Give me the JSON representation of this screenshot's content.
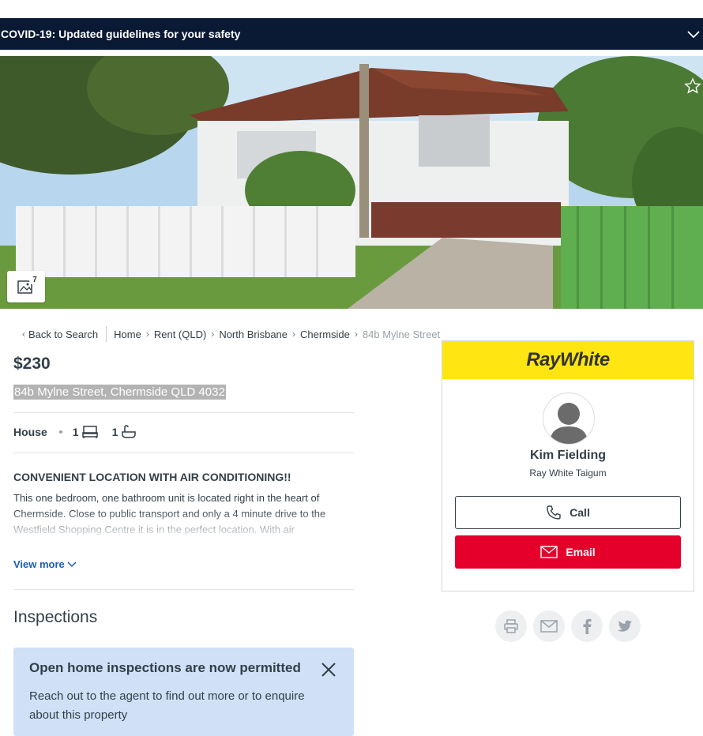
{
  "covid_banner": {
    "text": "COVID-19: Updated guidelines for your safety",
    "icon": "chevron-down-icon"
  },
  "hero": {
    "photo_count": "7",
    "favourite_icon": "star-icon",
    "gallery_icon": "gallery-icon"
  },
  "breadcrumb": {
    "back_label": "Back to Search",
    "items": [
      "Home",
      "Rent (QLD)",
      "North Brisbane",
      "Chermside"
    ],
    "current": "84b Mylne Street"
  },
  "listing": {
    "price": "$230",
    "address": "84b Mylne Street, Chermside QLD 4032",
    "property_type": "House",
    "bedrooms": "1",
    "bathrooms": "1",
    "headline": "CONVENIENT LOCATION WITH AIR CONDITIONING!!",
    "description": "This one bedroom, one bathroom unit is located right in the heart of Chermside. Close to public transport and only a 4 minute drive to the Westfield Shopping Centre it is in the perfect location. With air",
    "view_more_label": "View more"
  },
  "inspections": {
    "title": "Inspections",
    "notice_heading": "Open home inspections are now permitted",
    "notice_body": "Reach out to the agent to find out more or to enquire about this property"
  },
  "agent": {
    "agency_logo_text": "RayWhite",
    "name": "Kim Fielding",
    "agency": "Ray White Taigum",
    "call_label": "Call",
    "email_label": "Email",
    "brand_color": "#ffe512",
    "email_color": "#e4002b"
  },
  "share": {
    "icons": [
      "print-icon",
      "email-share-icon",
      "facebook-icon",
      "twitter-icon"
    ]
  }
}
